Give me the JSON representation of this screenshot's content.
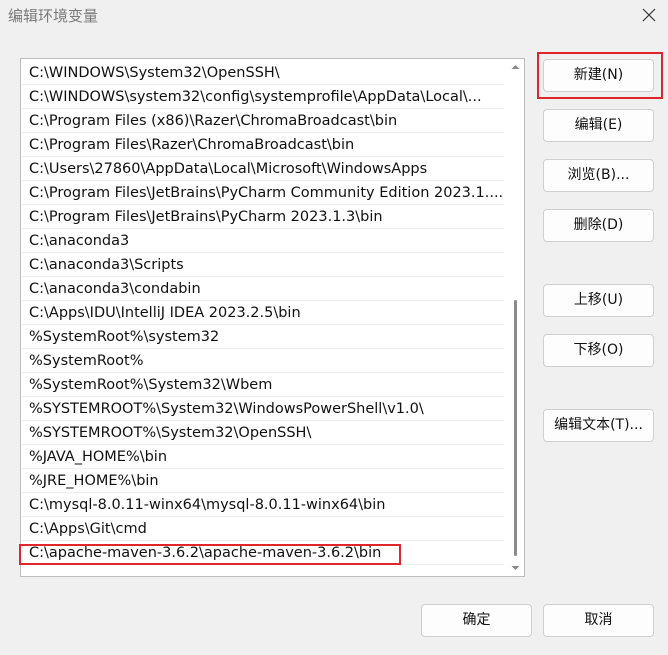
{
  "window": {
    "title": "编辑环境变量",
    "close_icon": "close-icon"
  },
  "paths": [
    "C:\\WINDOWS\\System32\\OpenSSH\\",
    "C:\\WINDOWS\\system32\\config\\systemprofile\\AppData\\Local\\...",
    "C:\\Program Files (x86)\\Razer\\ChromaBroadcast\\bin",
    "C:\\Program Files\\Razer\\ChromaBroadcast\\bin",
    "C:\\Users\\27860\\AppData\\Local\\Microsoft\\WindowsApps",
    "C:\\Program Files\\JetBrains\\PyCharm Community Edition 2023.1....",
    "C:\\Program Files\\JetBrains\\PyCharm 2023.1.3\\bin",
    "C:\\anaconda3",
    "C:\\anaconda3\\Scripts",
    "C:\\anaconda3\\condabin",
    "C:\\Apps\\IDU\\IntelliJ IDEA 2023.2.5\\bin",
    "%SystemRoot%\\system32",
    "%SystemRoot%",
    "%SystemRoot%\\System32\\Wbem",
    "%SYSTEMROOT%\\System32\\WindowsPowerShell\\v1.0\\",
    "%SYSTEMROOT%\\System32\\OpenSSH\\",
    "%JAVA_HOME%\\bin",
    "%JRE_HOME%\\bin",
    "C:\\mysql-8.0.11-winx64\\mysql-8.0.11-winx64\\bin",
    "C:\\Apps\\Git\\cmd",
    "C:\\apache-maven-3.6.2\\apache-maven-3.6.2\\bin"
  ],
  "buttons": {
    "new": "新建(N)",
    "edit": "编辑(E)",
    "browse": "浏览(B)...",
    "delete": "删除(D)",
    "move_up": "上移(U)",
    "move_down": "下移(O)",
    "edit_text": "编辑文本(T)...",
    "ok": "确定",
    "cancel": "取消"
  },
  "colors": {
    "highlight_border": "#e0262a",
    "background": "#f0f0f0",
    "list_background": "#ffffff"
  }
}
